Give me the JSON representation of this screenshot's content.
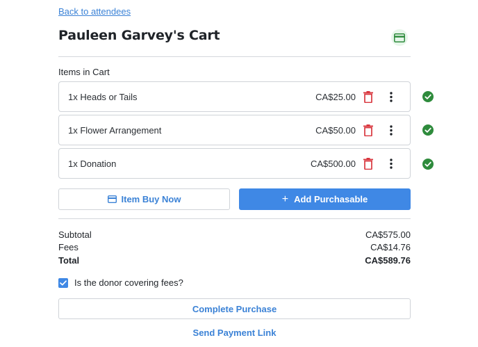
{
  "nav": {
    "back_label": "Back to attendees"
  },
  "header": {
    "title": "Pauleen Garvey's Cart",
    "payment_icon": "credit-card-icon"
  },
  "cart": {
    "section_label": "Items in Cart",
    "items": [
      {
        "name": "1x Heads or Tails",
        "price": "CA$25.00"
      },
      {
        "name": "1x Flower Arrangement",
        "price": "CA$50.00"
      },
      {
        "name": "1x Donation",
        "price": "CA$500.00"
      }
    ]
  },
  "actions": {
    "item_buy_now_label": "Item Buy Now",
    "add_purchasable_label": "Add Purchasable"
  },
  "summary": {
    "subtotal_label": "Subtotal",
    "subtotal_value": "CA$575.00",
    "fees_label": "Fees",
    "fees_value": "CA$14.76",
    "total_label": "Total",
    "total_value": "CA$589.76"
  },
  "donor_fees": {
    "label": "Is the donor covering fees?",
    "checked": true
  },
  "footer": {
    "complete_label": "Complete Purchase",
    "send_link_label": "Send Payment Link"
  },
  "colors": {
    "accent": "#3f88e5",
    "link": "#3b82d6",
    "danger": "#d9363e",
    "success": "#2e8b3c"
  }
}
